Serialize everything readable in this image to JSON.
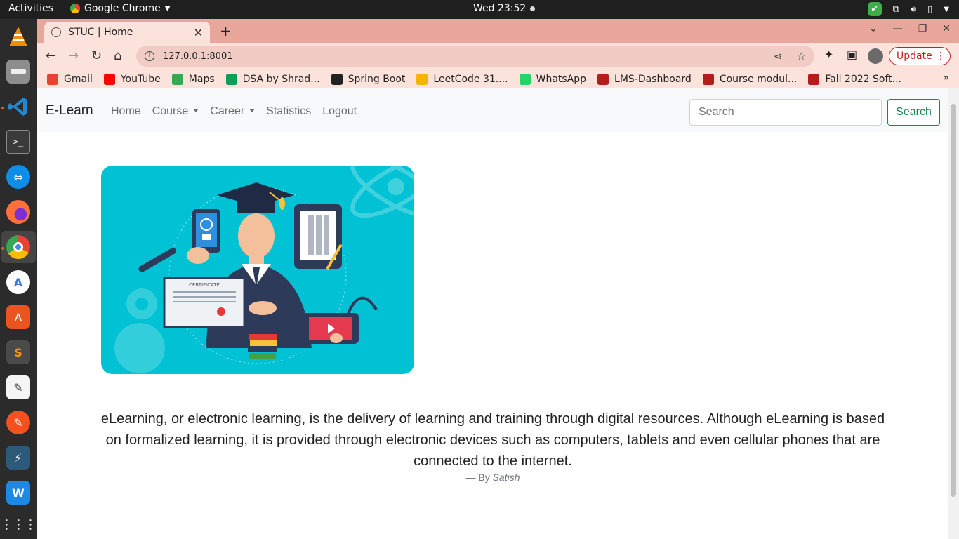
{
  "system": {
    "activities": "Activities",
    "app_name": "Google Chrome",
    "clock": "Wed 23:52"
  },
  "browser": {
    "tab_title": "STUC | Home",
    "url": "127.0.0.1:8001",
    "update_label": "Update",
    "bookmarks": [
      {
        "label": "Gmail",
        "icon": "gmail-icon",
        "color": "#ea4335"
      },
      {
        "label": "YouTube",
        "icon": "youtube-icon",
        "color": "#ff0000"
      },
      {
        "label": "Maps",
        "icon": "maps-icon",
        "color": "#34a853"
      },
      {
        "label": "DSA by Shrad...",
        "icon": "sheets-icon",
        "color": "#0f9d58"
      },
      {
        "label": "Spring Boot",
        "icon": "github-icon",
        "color": "#222222"
      },
      {
        "label": "LeetCode 31....",
        "icon": "pencil-icon",
        "color": "#f4b400"
      },
      {
        "label": "WhatsApp",
        "icon": "whatsapp-icon",
        "color": "#25d366"
      },
      {
        "label": "LMS-Dashboard",
        "icon": "lms-icon",
        "color": "#b71c1c"
      },
      {
        "label": "Course modul...",
        "icon": "university-icon",
        "color": "#b71c1c"
      },
      {
        "label": "Fall 2022 Soft...",
        "icon": "university-icon",
        "color": "#b71c1c"
      }
    ]
  },
  "site": {
    "brand": "E-Learn",
    "nav": {
      "home": "Home",
      "course": "Course",
      "career": "Career",
      "statistics": "Statistics",
      "logout": "Logout"
    },
    "search_placeholder": "Search",
    "search_button": "Search",
    "hero_image": {
      "certificate_text": "CERTIFICATE"
    },
    "quote": "eLearning, or electronic learning, is the delivery of learning and training through digital resources. Although eLearning is based on formalized learning, it is provided through electronic devices such as computers, tablets and even cellular phones that are connected to the internet.",
    "byline_prefix": "— By",
    "author": "Satish"
  },
  "colors": {
    "accent_green": "#198754",
    "hero_bg": "#00c2d4",
    "tab_bar": "#e8a79a"
  }
}
